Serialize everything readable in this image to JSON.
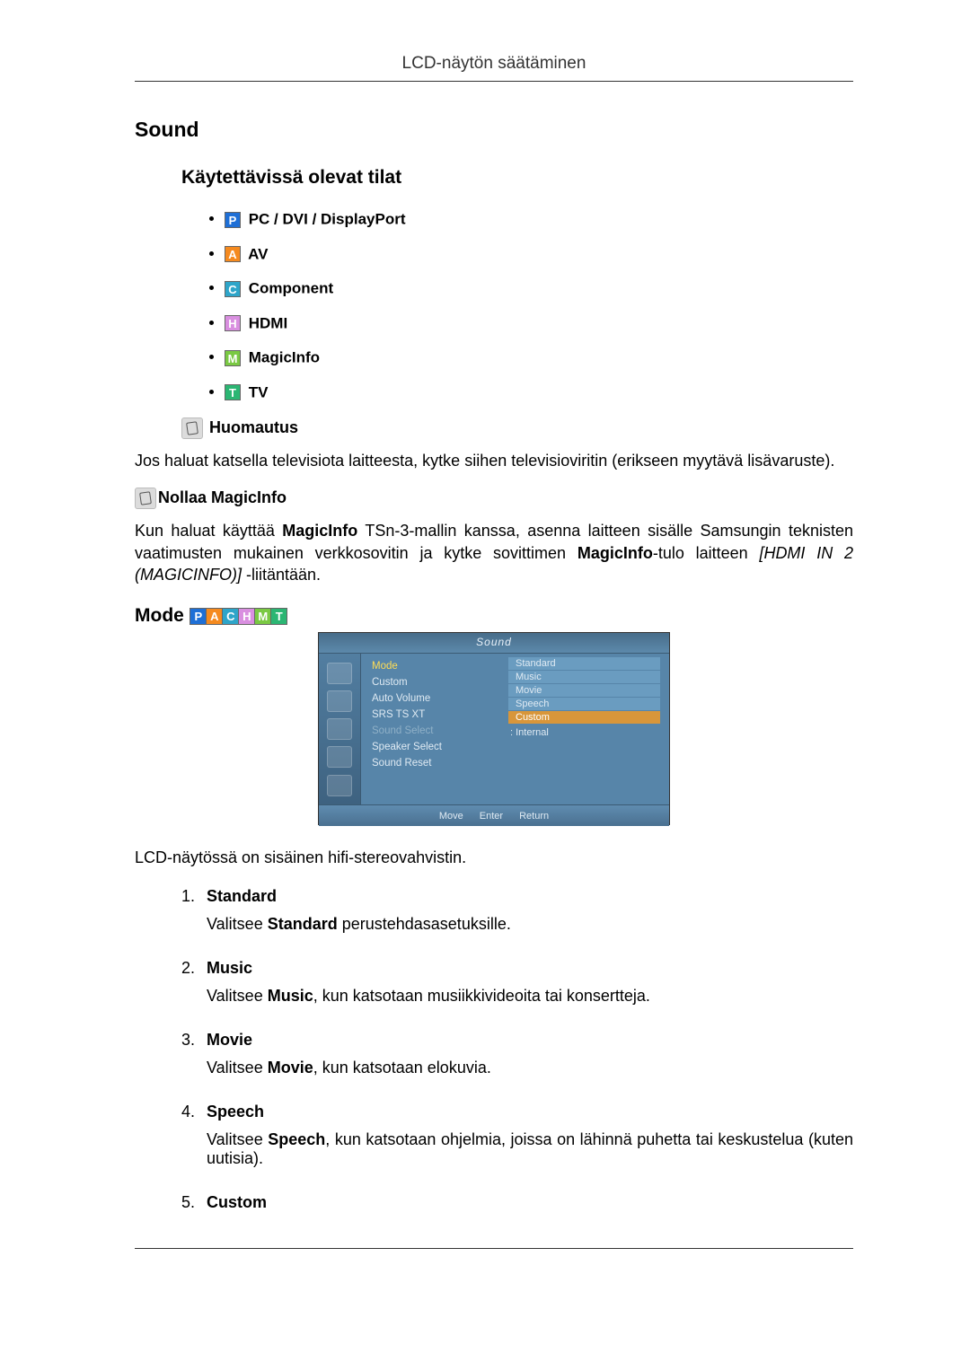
{
  "header": "LCD-näytön säätäminen",
  "section_title": "Sound",
  "subsection_title": "Käytettävissä olevat tilat",
  "modes": [
    {
      "icon": "P",
      "cls": "icon-p",
      "label": " PC / DVI / DisplayPort"
    },
    {
      "icon": "A",
      "cls": "icon-a",
      "label": " AV"
    },
    {
      "icon": "C",
      "cls": "icon-c",
      "label": " Component"
    },
    {
      "icon": "H",
      "cls": "icon-h",
      "label": " HDMI"
    },
    {
      "icon": "M",
      "cls": "icon-m",
      "label": " MagicInfo"
    },
    {
      "icon": "T",
      "cls": "icon-t",
      "label": " TV"
    }
  ],
  "note1_title": " Huomautus",
  "note1_body": "Jos haluat katsella televisiota laitteesta, kytke siihen televisioviritin (erikseen myytävä lisävaruste).",
  "note2_title": "Nollaa MagicInfo",
  "note2_body_parts": {
    "p1": "Kun haluat käyttää ",
    "b1": "MagicInfo",
    "p2": " TSn-3-mallin kanssa, asenna laitteen sisälle Samsungin teknisten vaatimusten mukainen verkkosovitin ja kytke sovittimen ",
    "b2": "MagicInfo",
    "p3": "-tulo laitteen ",
    "i1": "[HDMI IN 2 (MAGICINFO)]",
    "p4": " -liitäntään."
  },
  "mode_heading": "Mode",
  "osd": {
    "title": "Sound",
    "left_items": [
      {
        "text": "Mode",
        "cls": "hl"
      },
      {
        "text": "Custom",
        "cls": ""
      },
      {
        "text": "Auto Volume",
        "cls": ""
      },
      {
        "text": "SRS TS XT",
        "cls": ""
      },
      {
        "text": "Sound Select",
        "cls": "dim"
      },
      {
        "text": "Speaker Select",
        "cls": ""
      },
      {
        "text": "Sound Reset",
        "cls": ""
      }
    ],
    "options": [
      {
        "text": "Standard",
        "sel": false
      },
      {
        "text": "Music",
        "sel": false
      },
      {
        "text": "Movie",
        "sel": false
      },
      {
        "text": "Speech",
        "sel": false
      },
      {
        "text": "Custom",
        "sel": true
      }
    ],
    "internal": ": Internal",
    "footer": [
      "Move",
      "Enter",
      "Return"
    ]
  },
  "after_osd": "LCD-näytössä on sisäinen hifi-stereovahvistin.",
  "num_items": [
    {
      "n": "1.",
      "title": "Standard",
      "desc_pre": "Valitsee ",
      "desc_b": "Standard",
      "desc_post": " perustehdasasetuksille."
    },
    {
      "n": "2.",
      "title": "Music",
      "desc_pre": "Valitsee ",
      "desc_b": "Music",
      "desc_post": ", kun katsotaan musiikkivideoita tai konsertteja."
    },
    {
      "n": "3.",
      "title": "Movie",
      "desc_pre": "Valitsee ",
      "desc_b": "Movie",
      "desc_post": ", kun katsotaan elokuvia."
    },
    {
      "n": "4.",
      "title": "Speech",
      "desc_pre": "Valitsee ",
      "desc_b": "Speech",
      "desc_post": ", kun katsotaan ohjelmia, joissa on lähinnä puhetta tai keskustelua (kuten uutisia)."
    },
    {
      "n": "5.",
      "title": "Custom",
      "desc_pre": "",
      "desc_b": "",
      "desc_post": ""
    }
  ]
}
